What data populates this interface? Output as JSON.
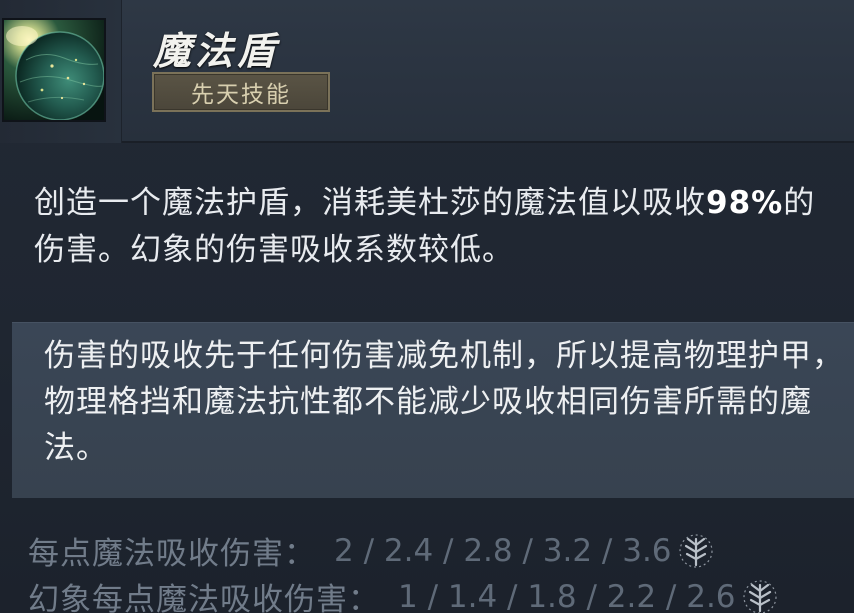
{
  "ability": {
    "name": "魔法盾",
    "badge": "先天技能",
    "icon": "mana-shield-orb-icon"
  },
  "description": {
    "part1": "创造一个魔法护盾，消耗美杜莎的魔法值以吸收",
    "highlight": "98%",
    "part2": "的伤害。幻象的伤害吸收系数较低。"
  },
  "note": {
    "text": "伤害的吸收先于任何伤害减免机制，所以提高物理护甲，物理格挡和魔法抗性都不能减少吸收相同伤害所需的魔法。"
  },
  "stats": [
    {
      "label": "每点魔法吸收伤害：",
      "values": "2 / 2.4 / 2.8 / 3.2 / 3.6",
      "icon": "aghanims-tree-icon"
    },
    {
      "label": "幻象每点魔法吸收伤害：",
      "values": "1 / 1.4 / 1.8 / 2.2 / 2.6",
      "icon": "aghanims-tree-icon"
    }
  ],
  "colors": {
    "background": "#1e2430",
    "header": "#2a3340",
    "note_panel": "#37424f",
    "badge_border": "#7b7259",
    "stat_text": "#6d7887"
  }
}
